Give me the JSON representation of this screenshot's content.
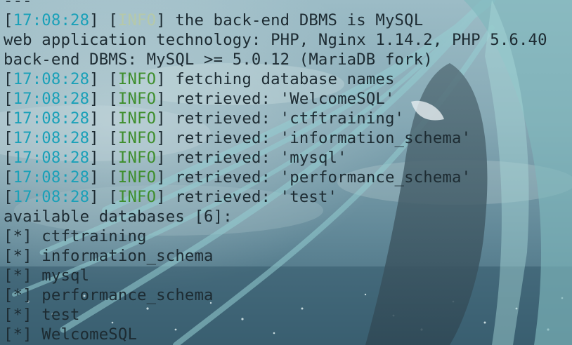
{
  "colors": {
    "timestamp": "#1aa0b8",
    "info": "#3e8e2c",
    "text": "#1d2b32"
  },
  "terminal": {
    "top_line": "---",
    "lines": [
      {
        "type": "log",
        "time": "17:08:28",
        "level": "INFO",
        "msg": " the back-end DBMS is MySQL",
        "faded": true
      },
      {
        "type": "text",
        "text": "web application technology: PHP, Nginx 1.14.2, PHP 5.6.40"
      },
      {
        "type": "text",
        "text": "back-end DBMS: MySQL >= 5.0.12 (MariaDB fork)"
      },
      {
        "type": "log",
        "time": "17:08:28",
        "level": "INFO",
        "msg": " fetching database names"
      },
      {
        "type": "log",
        "time": "17:08:28",
        "level": "INFO",
        "msg": " retrieved: 'WelcomeSQL'"
      },
      {
        "type": "log",
        "time": "17:08:28",
        "level": "INFO",
        "msg": " retrieved: 'ctftraining'"
      },
      {
        "type": "log",
        "time": "17:08:28",
        "level": "INFO",
        "msg": " retrieved: 'information_schema'"
      },
      {
        "type": "log",
        "time": "17:08:28",
        "level": "INFO",
        "msg": " retrieved: 'mysql'"
      },
      {
        "type": "log",
        "time": "17:08:28",
        "level": "INFO",
        "msg": " retrieved: 'performance_schema'"
      },
      {
        "type": "log",
        "time": "17:08:28",
        "level": "INFO",
        "msg": " retrieved: 'test'"
      },
      {
        "type": "text",
        "text": "available databases [6]:"
      },
      {
        "type": "text",
        "text": "[*] ctftraining"
      },
      {
        "type": "text",
        "text": "[*] information_schema"
      },
      {
        "type": "text",
        "text": "[*] mysql"
      },
      {
        "type": "text",
        "text": "[*] performance_schema"
      },
      {
        "type": "text",
        "text": "[*] test"
      },
      {
        "type": "text",
        "text": "[*] WelcomeSQL"
      }
    ]
  }
}
